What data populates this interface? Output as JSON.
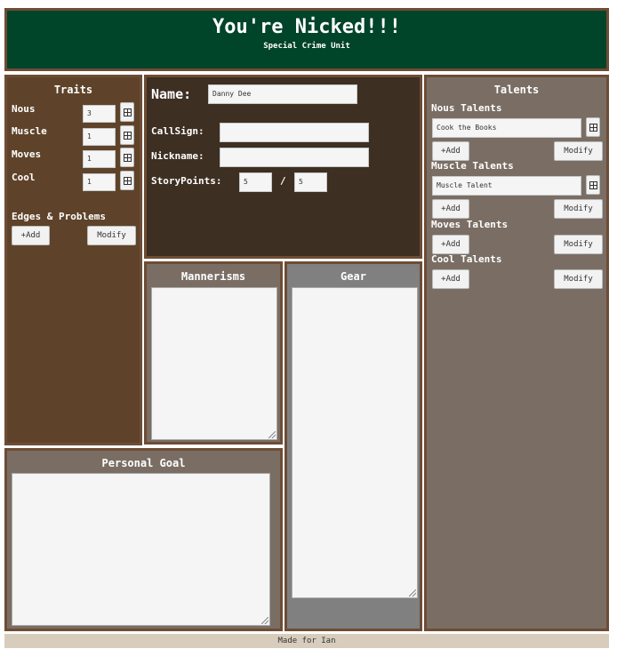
{
  "header": {
    "title": "You're Nicked!!!",
    "subtitle": "Special Crime Unit"
  },
  "traits": {
    "title": "Traits",
    "items": [
      {
        "label": "Nous",
        "value": "3"
      },
      {
        "label": "Muscle",
        "value": "1"
      },
      {
        "label": "Moves",
        "value": "1"
      },
      {
        "label": "Cool",
        "value": "1"
      }
    ],
    "edges_title": "Edges & Problems",
    "add_label": "+Add",
    "modify_label": "Modify"
  },
  "character": {
    "name_label": "Name:",
    "name_value": "Danny Dee",
    "callsign_label": "CallSign:",
    "callsign_value": "",
    "nickname_label": "Nickname:",
    "nickname_value": "",
    "storypoints_label": "StoryPoints:",
    "storypoints_current": "5",
    "storypoints_separator": "/",
    "storypoints_max": "5"
  },
  "talents": {
    "title": "Talents",
    "nous_title": "Nous Talents",
    "nous_value": "Cook the Books",
    "muscle_title": "Muscle Talents",
    "muscle_value": "Muscle Talent",
    "moves_title": "Moves Talents",
    "cool_title": "Cool Talents",
    "add_label": "+Add",
    "modify_label": "Modify"
  },
  "mannerisms": {
    "title": "Mannerisms"
  },
  "gear": {
    "title": "Gear"
  },
  "goal": {
    "title": "Personal Goal"
  },
  "footer": {
    "text": "Made for Ian"
  },
  "colors": {
    "header_bg": "#004429",
    "border": "#6e4c35",
    "traits_bg": "#5e432a",
    "name_bg": "#3d2f22",
    "talents_bg": "#7a6e64",
    "gear_bg": "#808080",
    "footer_bg": "#d8cdbd"
  }
}
